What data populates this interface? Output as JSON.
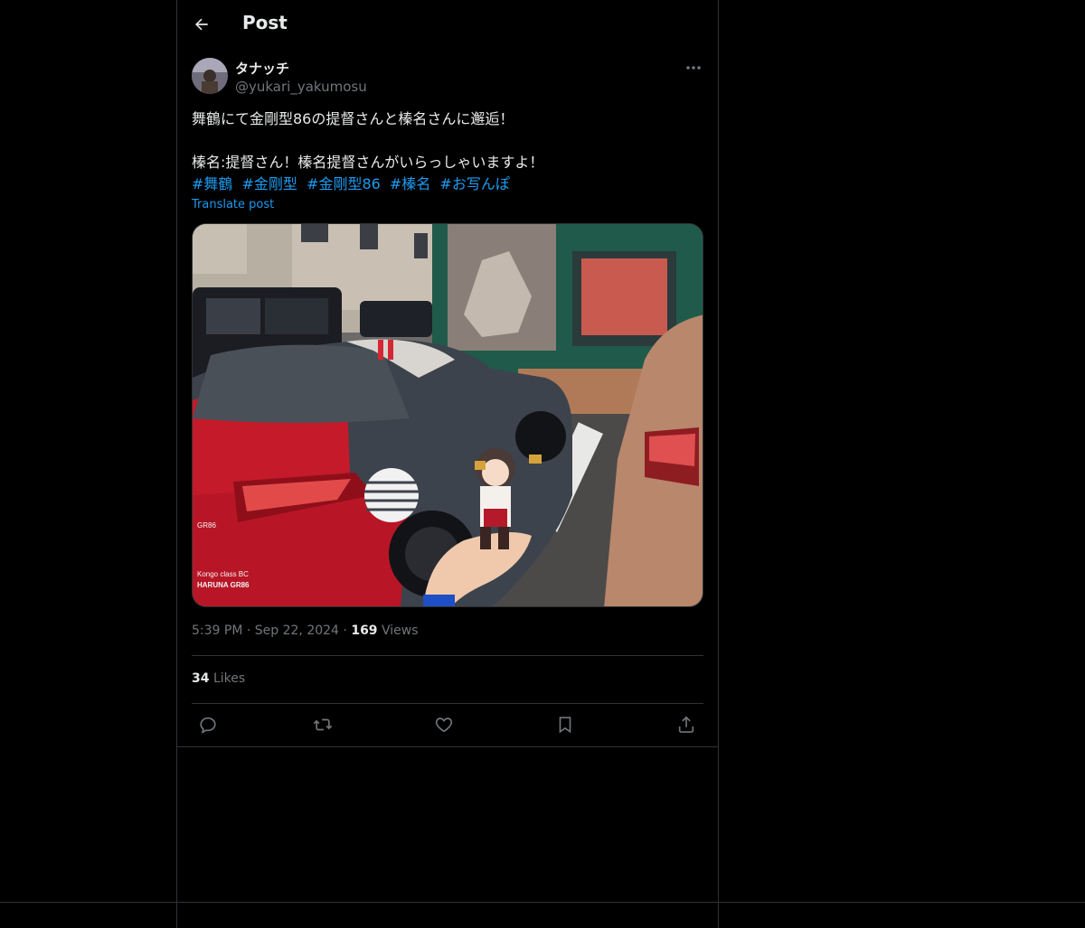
{
  "header": {
    "title": "Post"
  },
  "author": {
    "display_name": "タナッチ",
    "handle": "@yukari_yakumosu"
  },
  "post": {
    "lines": [
      "舞鶴にて金剛型86の提督さんと榛名さんに邂逅！",
      "",
      "榛名:提督さん！榛名提督さんがいらっしゃいますよ！"
    ],
    "hashtags": [
      "#舞鶴",
      "#金剛型",
      "#金剛型86",
      "#榛名",
      "#お写んぽ"
    ],
    "translate_label": "Translate post"
  },
  "media": {
    "car_text_1": "Kongo class BC",
    "car_text_2": "HARUNA GR86",
    "badge": "GR86"
  },
  "meta": {
    "time": "5:39 PM",
    "separator": "·",
    "date": "Sep 22, 2024",
    "views_count": "169",
    "views_label": "Views"
  },
  "stats": {
    "likes_count": "34",
    "likes_label": "Likes"
  },
  "icons": {
    "back": "arrow-left-icon",
    "more": "more-horizontal-icon",
    "reply": "reply-icon",
    "repost": "repost-icon",
    "like": "heart-icon",
    "bookmark": "bookmark-icon",
    "share": "share-icon"
  },
  "colors": {
    "background": "#000000",
    "text": "#e7e9ea",
    "muted": "#71767b",
    "accent": "#1d9bf0",
    "border": "#2f3336"
  }
}
